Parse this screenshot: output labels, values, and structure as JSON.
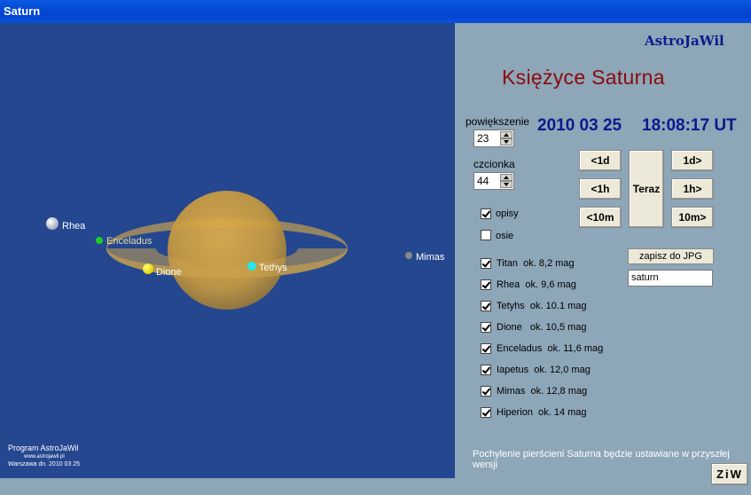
{
  "window": {
    "title": "Saturn"
  },
  "header": {
    "brand": "AstroJaWil",
    "title": "Księżyce Saturna"
  },
  "controls": {
    "zoom_label": "powiększenie",
    "zoom_value": "23",
    "font_label": "czcionka",
    "font_value": "44"
  },
  "datetime": {
    "date": "2010 03 25",
    "time": "18:08:17 UT"
  },
  "nav": {
    "minus_day": "<1d",
    "plus_day": "1d>",
    "minus_hour": "<1h",
    "plus_hour": "1h>",
    "minus_10min": "<10m",
    "plus_10min": "10m>",
    "now": "Teraz"
  },
  "options": {
    "descriptions": {
      "label": "opisy",
      "checked": true
    },
    "axes": {
      "label": "osie",
      "checked": false
    }
  },
  "moons_list": [
    {
      "name": "Titan",
      "mag": "ok. 8,2 mag",
      "checked": true
    },
    {
      "name": "Rhea",
      "mag": "ok. 9,6 mag",
      "checked": true
    },
    {
      "name": "Tetyhs",
      "mag": "ok. 10.1 mag",
      "checked": true
    },
    {
      "name": "Dione",
      "mag": "ok. 10,5 mag",
      "checked": true
    },
    {
      "name": "Enceladus",
      "mag": "ok. 11,6 mag",
      "checked": true
    },
    {
      "name": "Iapetus",
      "mag": "ok. 12,0 mag",
      "checked": true
    },
    {
      "name": "Mimas",
      "mag": "ok. 12,8 mag",
      "checked": true
    },
    {
      "name": "Hiperion",
      "mag": "ok. 14 mag",
      "checked": true
    }
  ],
  "export": {
    "button_label": "zapisz do JPG",
    "filename": "saturn"
  },
  "note": "Pochylenie pierścieni Saturna będzie ustawiane w przyszłej wersji",
  "corner_button": "ZiW",
  "credits": {
    "line1": "Program AstroJaWil",
    "line2": "www.astrojawil.pl",
    "line3": "Warszawa dn. 2010 03 25"
  },
  "sky_labels": {
    "rhea": "Rhea",
    "enceladus": "Enceladus",
    "dione": "Dione",
    "tethys": "Tethys",
    "mimas": "Mimas"
  },
  "colors": {
    "sky": "#24478f",
    "panel": "#8da6b8",
    "title_red": "#8b0a0a",
    "brand_blue": "#0a1a8c"
  }
}
